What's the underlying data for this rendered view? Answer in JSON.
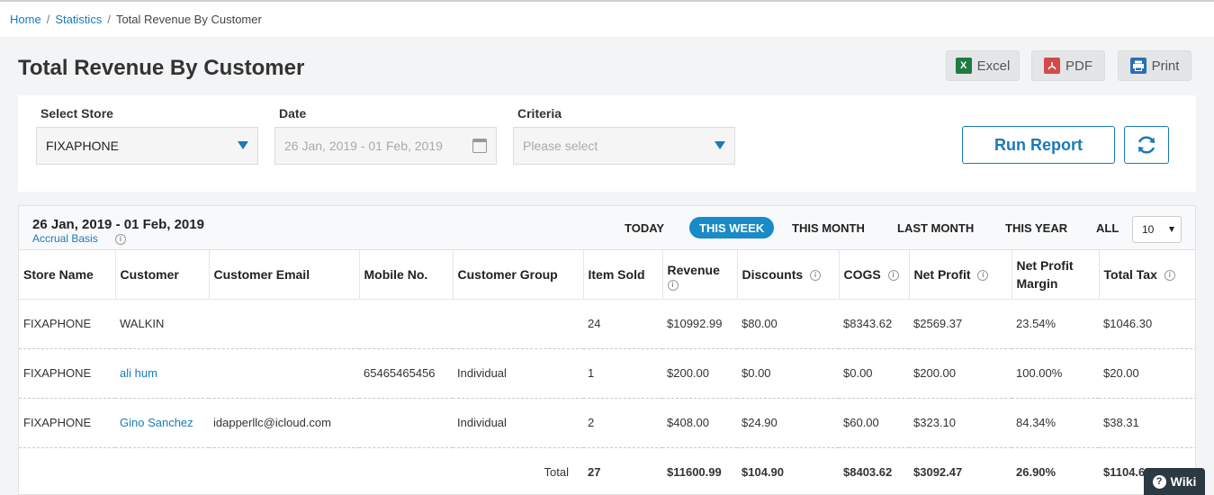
{
  "breadcrumb": {
    "home": "Home",
    "statistics": "Statistics",
    "current": "Total Revenue By Customer",
    "sep": "/"
  },
  "page": {
    "title": "Total Revenue By Customer"
  },
  "exports": {
    "excel": "Excel",
    "pdf": "PDF",
    "print": "Print"
  },
  "filters": {
    "store_label": "Select Store",
    "store_value": "FIXAPHONE",
    "date_label": "Date",
    "date_value": "26 Jan, 2019 - 01 Feb, 2019",
    "criteria_label": "Criteria",
    "criteria_placeholder": "Please select",
    "run_label": "Run Report"
  },
  "report": {
    "date_range": "26 Jan, 2019 - 01 Feb, 2019",
    "basis": "Accrual Basis",
    "periods": [
      "TODAY",
      "THIS WEEK",
      "THIS MONTH",
      "LAST MONTH",
      "THIS YEAR",
      "ALL"
    ],
    "active_period": "THIS WEEK",
    "page_size": "10"
  },
  "table": {
    "headers": {
      "store": "Store Name",
      "customer": "Customer",
      "email": "Customer Email",
      "mobile": "Mobile No.",
      "group": "Customer Group",
      "item_sold": "Item Sold",
      "revenue": "Revenue",
      "discounts": "Discounts",
      "cogs": "COGS",
      "net_profit": "Net Profit",
      "net_profit_margin": "Net Profit Margin",
      "total_tax": "Total Tax"
    },
    "rows": [
      {
        "store": "FIXAPHONE",
        "customer": "WALKIN",
        "email": "",
        "mobile": "",
        "group": "",
        "item_sold": "24",
        "revenue": "$10992.99",
        "discounts": "$80.00",
        "cogs": "$8343.62",
        "net_profit": "$2569.37",
        "margin": "23.54%",
        "tax": "$1046.30"
      },
      {
        "store": "FIXAPHONE",
        "customer": "ali hum",
        "email": "",
        "mobile": "65465465456",
        "group": "Individual",
        "item_sold": "1",
        "revenue": "$200.00",
        "discounts": "$0.00",
        "cogs": "$0.00",
        "net_profit": "$200.00",
        "margin": "100.00%",
        "tax": "$20.00"
      },
      {
        "store": "FIXAPHONE",
        "customer": "Gino Sanchez",
        "email": "idapperllc@icloud.com",
        "mobile": "",
        "group": "Individual",
        "item_sold": "2",
        "revenue": "$408.00",
        "discounts": "$24.90",
        "cogs": "$60.00",
        "net_profit": "$323.10",
        "margin": "84.34%",
        "tax": "$38.31"
      }
    ],
    "total": {
      "label": "Total",
      "item_sold": "27",
      "revenue": "$11600.99",
      "discounts": "$104.90",
      "cogs": "$8403.62",
      "net_profit": "$3092.47",
      "margin": "26.90%",
      "tax": "$1104.61"
    }
  },
  "wiki": {
    "label": "Wiki"
  },
  "colors": {
    "accent": "#1a7ab8",
    "pill": "#1a8ac8",
    "wiki_bg": "#2a3942"
  }
}
